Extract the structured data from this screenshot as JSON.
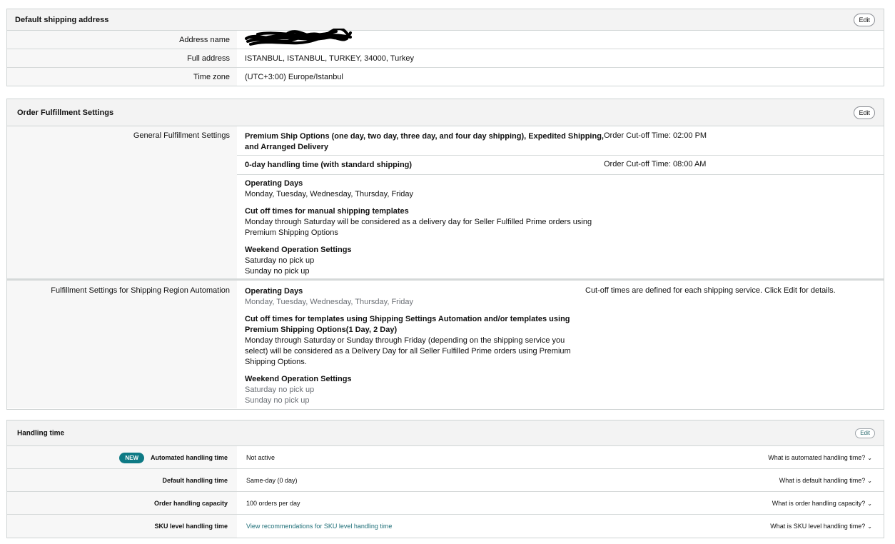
{
  "shipping_address": {
    "title": "Default shipping address",
    "edit_label": "Edit",
    "rows": [
      {
        "label": "Address name",
        "value": ""
      },
      {
        "label": "Full address",
        "value": "ISTANBUL, ISTANBUL, TURKEY, 34000, Turkey"
      },
      {
        "label": "Time zone",
        "value": "(UTC+3:00) Europe/Istanbul"
      }
    ]
  },
  "order_fulfillment": {
    "title": "Order Fulfillment Settings",
    "edit_label": "Edit",
    "general": {
      "label": "General Fulfillment Settings",
      "premium_line1": "Premium Ship Options (one day, two day, three day, and four day shipping), Expedited Shipping,",
      "premium_line2": "and Arranged Delivery",
      "premium_cutoff": "Order Cut-off Time: 02:00 PM",
      "zero_day": "0-day handling time (with standard shipping)",
      "zero_day_cutoff": "Order Cut-off Time: 08:00 AM",
      "operating_days_title": "Operating Days",
      "operating_days": "Monday, Tuesday, Wednesday, Thursday, Friday",
      "cutoff_manual_title": "Cut off times for manual shipping templates",
      "cutoff_manual_line1": "Monday through Saturday will be considered as a delivery day for Seller Fulfilled Prime orders using",
      "cutoff_manual_line2": "Premium Shipping Options",
      "weekend_title": "Weekend Operation Settings",
      "saturday": "Saturday no pick up",
      "sunday": "Sunday no pick up"
    },
    "automation": {
      "label": "Fulfillment Settings for Shipping Region Automation",
      "operating_days_title": "Operating Days",
      "operating_days": "Monday, Tuesday, Wednesday, Thursday, Friday",
      "cutoff_note": "Cut-off times are defined for each shipping service. Click Edit for details.",
      "cutoff_title_line1": "Cut off times for templates using Shipping Settings Automation and/or templates using",
      "cutoff_title_line2": "Premium Shipping Options(1 Day, 2 Day)",
      "cutoff_body_line1": "Monday through Saturday or Sunday through Friday (depending on the shipping service you",
      "cutoff_body_line2": "select) will be considered as a Delivery Day for all Seller Fulfilled Prime orders using Premium",
      "cutoff_body_line3": "Shipping Options.",
      "weekend_title": "Weekend Operation Settings",
      "saturday": "Saturday no pick up",
      "sunday": "Sunday no pick up"
    }
  },
  "handling_time": {
    "title": "Handling time",
    "edit_label": "Edit",
    "new_badge": "NEW",
    "rows": [
      {
        "label": "Automated handling time",
        "value": "Not active",
        "help": "What is automated handling time?"
      },
      {
        "label": "Default handling time",
        "value": "Same-day (0 day)",
        "help": "What is default handling time?"
      },
      {
        "label": "Order handling capacity",
        "value": "100 orders per day",
        "help": "What is order handling capacity?"
      },
      {
        "label": "SKU level handling time",
        "value": "View recommendations for SKU level handling time",
        "help": "What is SKU level handling time?"
      }
    ]
  },
  "colors": {
    "header_bg": "#f3f3f3",
    "label_bg": "#f7f7f7",
    "badge": "#0e7a85",
    "link": "#1f6f78"
  }
}
